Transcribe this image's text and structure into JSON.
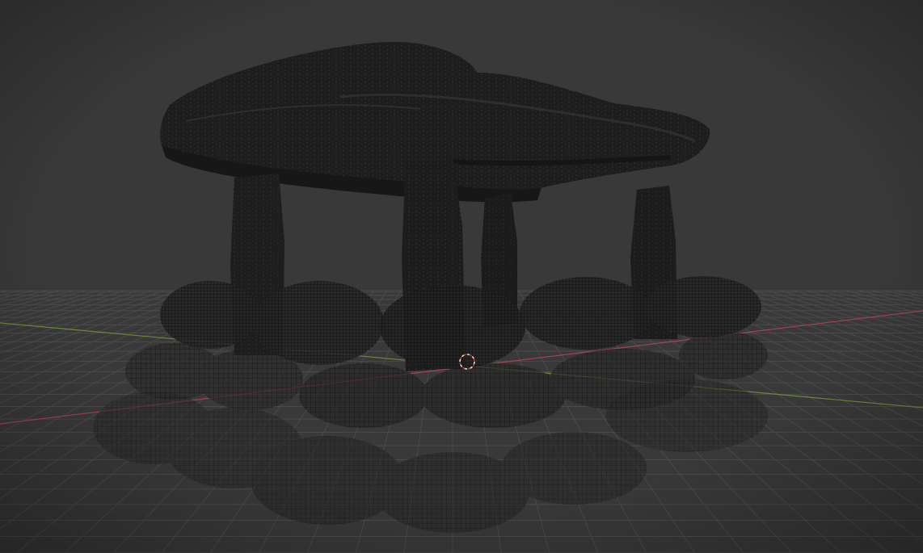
{
  "viewport": {
    "background_color": "#393939",
    "grid_color": "#4a4a4a",
    "x_axis_color": "#a3444f",
    "y_axis_color": "#6a8a3a",
    "mesh_fill_color": "#1f1f1f",
    "mesh_dark_color": "#141414",
    "wire_color": "#000000",
    "wire_highlight_color": "#6a6a6a",
    "cursor_ring_color": "#d9d9d9",
    "cursor_accent_color": "#c0392b",
    "shading_mode": "wireframe-xray",
    "scene_objects": [
      "roof-slab",
      "pillar-front-left",
      "pillar-front-center",
      "pillar-back-center",
      "pillar-right",
      "log-cushion-upper-row",
      "log-cushion-middle-row",
      "log-cushion-lower-row"
    ]
  }
}
